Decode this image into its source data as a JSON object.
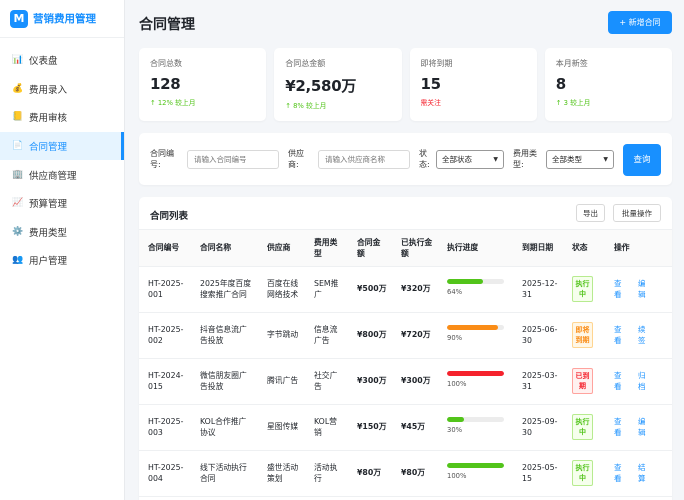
{
  "brand": {
    "logo": "M",
    "title": "营销费用管理",
    "color": "#1890ff"
  },
  "sidebar": {
    "items": [
      {
        "icon": "bar-chart-icon",
        "glyph": "📊",
        "label": "仪表盘",
        "active": false
      },
      {
        "icon": "money-bag-icon",
        "glyph": "💰",
        "label": "费用录入",
        "active": false
      },
      {
        "icon": "ledger-icon",
        "glyph": "📒",
        "label": "费用审核",
        "active": false
      },
      {
        "icon": "document-icon",
        "glyph": "📄",
        "label": "合同管理",
        "active": true
      },
      {
        "icon": "building-icon",
        "glyph": "🏢",
        "label": "供应商管理",
        "active": false
      },
      {
        "icon": "trend-chart-icon",
        "glyph": "📈",
        "label": "预算管理",
        "active": false
      },
      {
        "icon": "gear-icon",
        "glyph": "⚙️",
        "label": "费用类型",
        "active": false
      },
      {
        "icon": "users-icon",
        "glyph": "👥",
        "label": "用户管理",
        "active": false
      }
    ]
  },
  "header": {
    "title": "合同管理",
    "new_button": "+ 新增合同"
  },
  "stats": [
    {
      "label": "合同总数",
      "value": "128",
      "sub": "↑ 12% 较上月",
      "tone": "up"
    },
    {
      "label": "合同总金额",
      "value": "¥2,580万",
      "sub": "↑ 8% 较上月",
      "tone": "up"
    },
    {
      "label": "即将到期",
      "value": "15",
      "sub": "需关注",
      "tone": "warn"
    },
    {
      "label": "本月新签",
      "value": "8",
      "sub": "↑ 3 较上月",
      "tone": "up"
    }
  ],
  "filter": {
    "contract_no_label": "合同编号:",
    "contract_no_placeholder": "请输入合同编号",
    "supplier_label": "供应商:",
    "supplier_placeholder": "请输入供应商名称",
    "status_label": "状态:",
    "status_value": "全部状态",
    "type_label": "费用类型:",
    "type_value": "全部类型",
    "query_button": "查询"
  },
  "table": {
    "title": "合同列表",
    "export_button": "导出",
    "batch_button": "批量操作",
    "columns": [
      "合同编号",
      "合同名称",
      "供应商",
      "费用类型",
      "合同金额",
      "已执行金额",
      "执行进度",
      "到期日期",
      "状态",
      "操作"
    ],
    "rows": [
      {
        "id": "HT-2025-001",
        "name": "2025年度百度搜索推广合同",
        "supplier": "百度在线网络技术",
        "type": "SEM推广",
        "amount": "¥500万",
        "executed": "¥320万",
        "progress": 64,
        "progress_label": "64%",
        "bar_color": "#52c41a",
        "due": "2025-12-31",
        "status": "执行中",
        "status_tone": "green",
        "actions": [
          "查看",
          "编辑"
        ]
      },
      {
        "id": "HT-2025-002",
        "name": "抖音信息流广告投放",
        "supplier": "字节跳动",
        "type": "信息流广告",
        "amount": "¥800万",
        "executed": "¥720万",
        "progress": 90,
        "progress_label": "90%",
        "bar_color": "#fa8c16",
        "due": "2025-06-30",
        "status": "即将到期",
        "status_tone": "orange",
        "actions": [
          "查看",
          "续签"
        ]
      },
      {
        "id": "HT-2024-015",
        "name": "微信朋友圈广告投放",
        "supplier": "腾讯广告",
        "type": "社交广告",
        "amount": "¥300万",
        "executed": "¥300万",
        "progress": 100,
        "progress_label": "100%",
        "bar_color": "#f5222d",
        "due": "2025-03-31",
        "status": "已到期",
        "status_tone": "red",
        "actions": [
          "查看",
          "归档"
        ]
      },
      {
        "id": "HT-2025-003",
        "name": "KOL合作推广协议",
        "supplier": "星图传媒",
        "type": "KOL营销",
        "amount": "¥150万",
        "executed": "¥45万",
        "progress": 30,
        "progress_label": "30%",
        "bar_color": "#52c41a",
        "due": "2025-09-30",
        "status": "执行中",
        "status_tone": "green",
        "actions": [
          "查看",
          "编辑"
        ]
      },
      {
        "id": "HT-2025-004",
        "name": "线下活动执行合同",
        "supplier": "盛世活动策划",
        "type": "活动执行",
        "amount": "¥80万",
        "executed": "¥80万",
        "progress": 100,
        "progress_label": "100%",
        "bar_color": "#52c41a",
        "due": "2025-05-15",
        "status": "执行中",
        "status_tone": "green",
        "actions": [
          "查看",
          "结算"
        ]
      }
    ]
  }
}
